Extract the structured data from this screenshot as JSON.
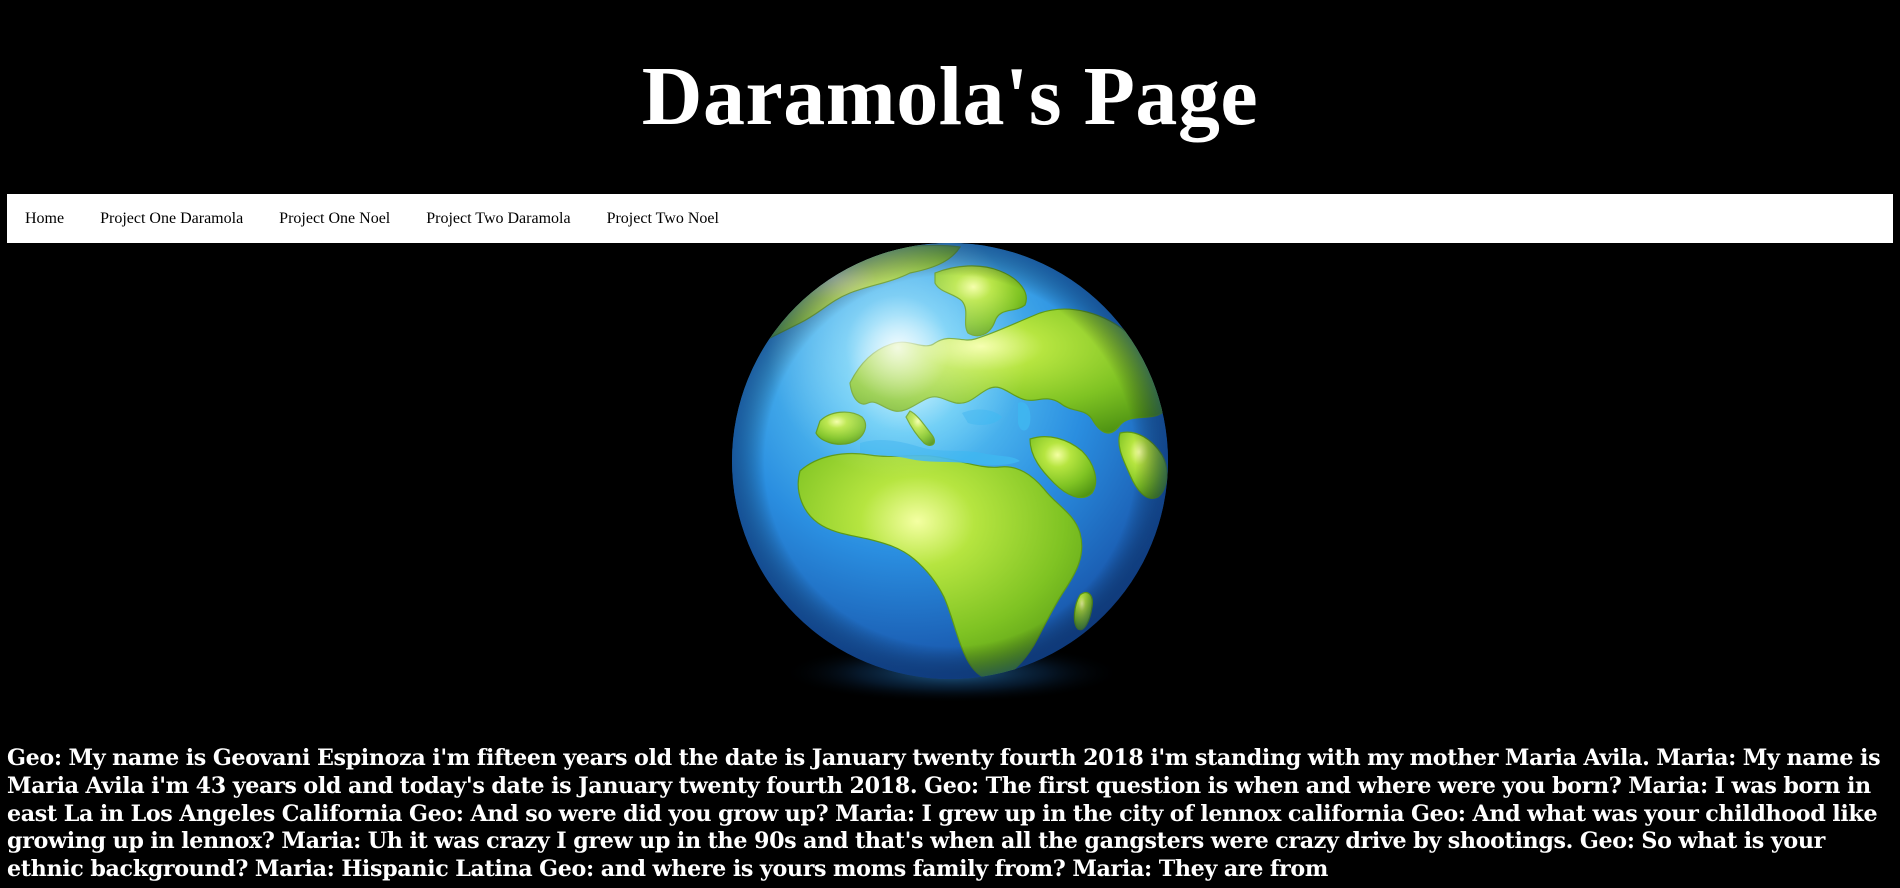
{
  "header": {
    "title": "Daramola's Page"
  },
  "nav": {
    "items": [
      {
        "label": "Home"
      },
      {
        "label": "Project One Daramola"
      },
      {
        "label": "Project One Noel"
      },
      {
        "label": "Project Two Daramola"
      },
      {
        "label": "Project Two Noel"
      }
    ]
  },
  "hero": {
    "icon": "earth-globe-icon"
  },
  "content": {
    "transcript": "Geo: My name is Geovani Espinoza i'm fifteen years old the date is January twenty fourth 2018 i'm standing with my mother Maria Avila. Maria: My name is Maria Avila i'm 43 years old and today's date is January twenty fourth 2018. Geo: The first question is when and where were you born? Maria: I was born in east La in Los Angeles California Geo: And so were did you grow up? Maria: I grew up in the city of lennox california Geo: And what was your childhood like growing up in lennox? Maria: Uh it was crazy I grew up in the 90s and that's when all the gangsters were crazy drive by shootings. Geo: So what is your ethnic background? Maria: Hispanic Latina Geo: and where is yours moms family from? Maria: They are from"
  },
  "colors": {
    "background": "#000000",
    "nav_background": "#ffffff",
    "ocean": "#2a8ee0",
    "land": "#8fd12e"
  }
}
